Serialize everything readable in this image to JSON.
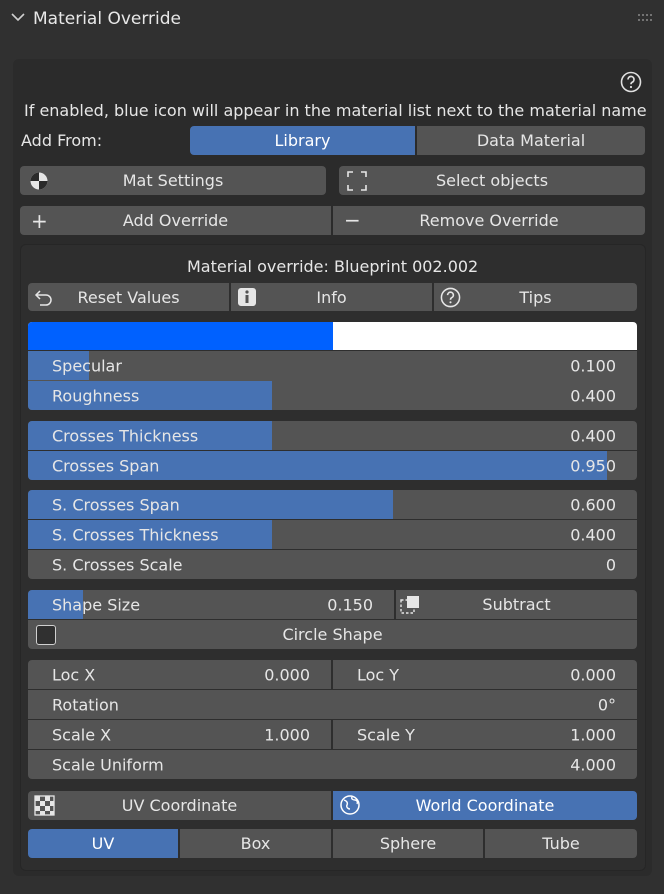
{
  "header": {
    "title": "Material Override",
    "collapse_icon": "chevron-down-icon",
    "drag_icon": "grip-dots-icon"
  },
  "help_icon": "question-circle-icon",
  "info_text": "If enabled, blue icon will appear in the material list next to the material name",
  "add_from": {
    "label": "Add From:",
    "options": [
      "Library",
      "Data Material"
    ],
    "selected": "Library"
  },
  "actions": {
    "mat_settings": "Mat Settings",
    "select_objects": "Select objects",
    "add_override": "Add Override",
    "remove_override": "Remove Override"
  },
  "override": {
    "title": "Material override: Blueprint 002.002",
    "reset_values": "Reset Values",
    "info": "Info",
    "tips": "Tips",
    "color_split": 0.5,
    "colors": {
      "left": "#0061ff",
      "right": "#ffffff",
      "accent": "#4772b3"
    },
    "group1": [
      {
        "label": "Specular",
        "value": "0.100",
        "fraction": 0.1
      },
      {
        "label": "Roughness",
        "value": "0.400",
        "fraction": 0.4
      }
    ],
    "group2": [
      {
        "label": "Crosses Thickness",
        "value": "0.400",
        "fraction": 0.4
      },
      {
        "label": "Crosses Span",
        "value": "0.950",
        "fraction": 0.95
      }
    ],
    "group3": [
      {
        "label": "S. Crosses Span",
        "value": "0.600",
        "fraction": 0.6
      },
      {
        "label": "S. Crosses Thickness",
        "value": "0.400",
        "fraction": 0.4
      },
      {
        "label": "S. Crosses Scale",
        "value": "0",
        "fraction": 0
      }
    ],
    "shape_size": {
      "label": "Shape Size",
      "value": "0.150",
      "fraction": 0.15
    },
    "subtract": "Subtract",
    "circle_shape": {
      "label": "Circle Shape",
      "checked": false
    },
    "transform": {
      "loc_x": {
        "label": "Loc X",
        "value": "0.000"
      },
      "loc_y": {
        "label": "Loc Y",
        "value": "0.000"
      },
      "rotation": {
        "label": "Rotation",
        "value": "0°"
      },
      "scale_x": {
        "label": "Scale X",
        "value": "1.000"
      },
      "scale_y": {
        "label": "Scale Y",
        "value": "1.000"
      },
      "scale_uniform": {
        "label": "Scale Uniform",
        "value": "4.000"
      }
    },
    "coordinate": {
      "options": [
        "UV Coordinate",
        "World Coordinate"
      ],
      "selected": "World Coordinate"
    },
    "projection": {
      "options": [
        "UV",
        "Box",
        "Sphere",
        "Tube"
      ],
      "selected": "UV"
    }
  }
}
